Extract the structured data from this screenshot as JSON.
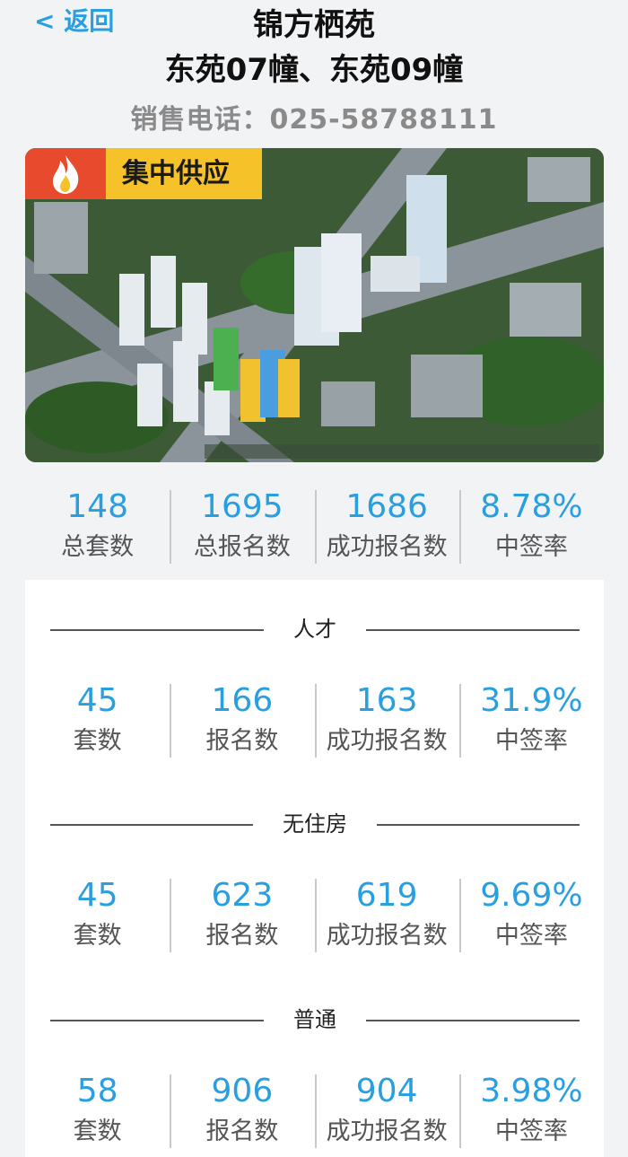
{
  "header": {
    "back_label": "< 返回",
    "title_line1": "锦方栖苑",
    "title_line2": "东苑07幢、东苑09幢",
    "phone": "销售电话：025-58788111"
  },
  "hero": {
    "badge": "集中供应"
  },
  "summary": [
    {
      "value": "148",
      "label": "总套数"
    },
    {
      "value": "1695",
      "label": "总报名数"
    },
    {
      "value": "1686",
      "label": "成功报名数"
    },
    {
      "value": "8.78%",
      "label": "中签率"
    }
  ],
  "sections": [
    {
      "title": "人才",
      "stats": [
        {
          "value": "45",
          "label": "套数"
        },
        {
          "value": "166",
          "label": "报名数"
        },
        {
          "value": "163",
          "label": "成功报名数"
        },
        {
          "value": "31.9%",
          "label": "中签率"
        }
      ]
    },
    {
      "title": "无住房",
      "stats": [
        {
          "value": "45",
          "label": "套数"
        },
        {
          "value": "623",
          "label": "报名数"
        },
        {
          "value": "619",
          "label": "成功报名数"
        },
        {
          "value": "9.69%",
          "label": "中签率"
        }
      ]
    },
    {
      "title": "普通",
      "stats": [
        {
          "value": "58",
          "label": "套数"
        },
        {
          "value": "906",
          "label": "报名数"
        },
        {
          "value": "904",
          "label": "成功报名数"
        },
        {
          "value": "3.98%",
          "label": "中签率"
        }
      ]
    }
  ],
  "colors": {
    "accent": "#2a9fe0",
    "background": "#f2f3f5",
    "badge_yellow": "#f6c22a",
    "badge_red": "#e74a2c"
  }
}
